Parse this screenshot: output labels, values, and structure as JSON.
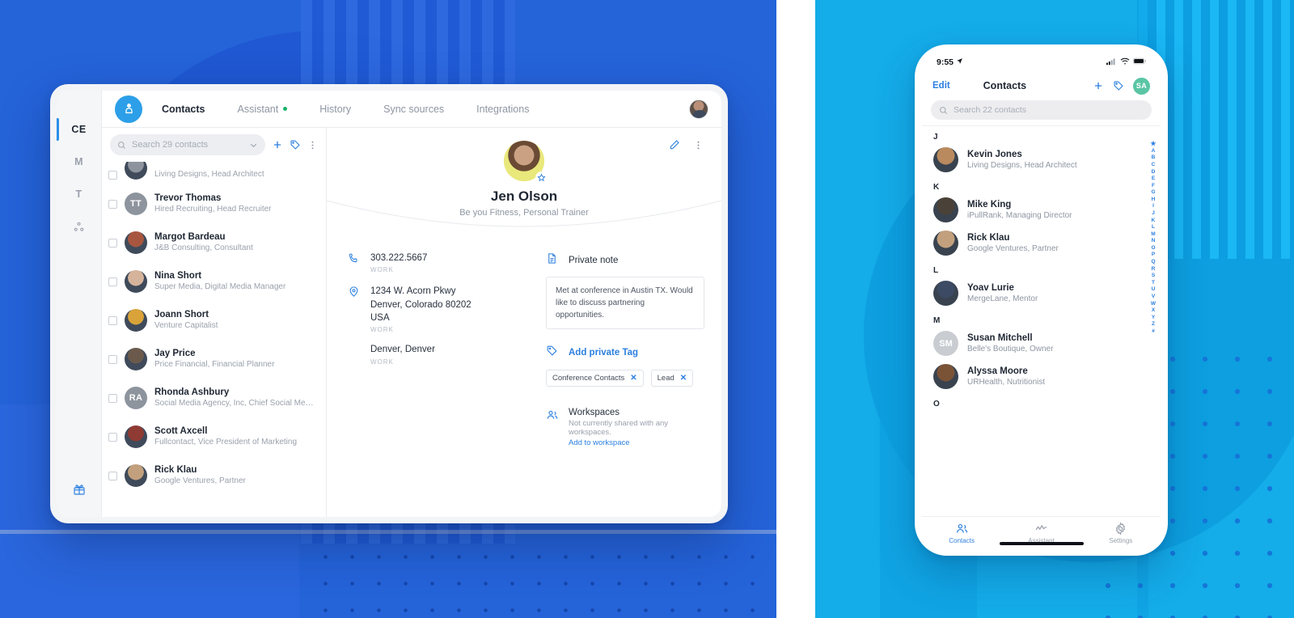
{
  "theme": {
    "left_bg": "#2563d9",
    "right_bg": "#14ace9",
    "accent_blue": "#2b7fe0",
    "logo_blue": "#2c9fe8",
    "green_dot": "#17b26a",
    "avatar_green": "#5ac5a5"
  },
  "desktop": {
    "logo_icon": "contact-card-icon",
    "tabs": [
      {
        "label": "Contacts",
        "active": true,
        "dot": false
      },
      {
        "label": "Assistant",
        "active": false,
        "dot": true
      },
      {
        "label": "History",
        "active": false,
        "dot": false
      },
      {
        "label": "Sync sources",
        "active": false,
        "dot": false
      },
      {
        "label": "Integrations",
        "active": false,
        "dot": false
      }
    ],
    "rail": [
      {
        "label": "CE",
        "active": true
      },
      {
        "label": "M",
        "active": false
      },
      {
        "label": "T",
        "active": false
      },
      {
        "label": "",
        "icon": "network-icon",
        "active": false
      }
    ],
    "rail_bottom_icon": "gift-icon",
    "list": {
      "search_placeholder": "Search 29 contacts",
      "chevron_icon": "chevron-down-icon",
      "add_icon": "plus-icon",
      "tag_icon": "tag-icon",
      "more_icon": "more-vertical-icon",
      "contacts": [
        {
          "name": "",
          "desc": "Living Designs, Head Architect",
          "initials": "",
          "color": "#8d949d",
          "partial": true
        },
        {
          "name": "Trevor Thomas",
          "desc": "Hired Recruiting, Head Recruiter",
          "initials": "TT",
          "color": "#8d949d"
        },
        {
          "name": "Margot Bardeau",
          "desc": "J&B Consulting, Consultant",
          "initials": "",
          "color": "#a8563f"
        },
        {
          "name": "Nina Short",
          "desc": "Super Media, Digital Media Manager",
          "initials": "",
          "color": "#d6b49c"
        },
        {
          "name": "Joann Short",
          "desc": "Venture Capitalist",
          "initials": "",
          "color": "#d9a33a"
        },
        {
          "name": "Jay Price",
          "desc": "Price Financial, Financial Planner",
          "initials": "",
          "color": "#6b5a4c"
        },
        {
          "name": "Rhonda Ashbury",
          "desc": "Social Media Agency, Inc, Chief Social Media St...",
          "initials": "RA",
          "color": "#8d949d"
        },
        {
          "name": "Scott Axcell",
          "desc": "Fullcontact, Vice President of Marketing",
          "initials": "",
          "color": "#8f3a33"
        },
        {
          "name": "Rick Klau",
          "desc": "Google Ventures, Partner",
          "initials": "",
          "color": "#c2a07d"
        }
      ]
    },
    "detail": {
      "edit_icon": "pencil-icon",
      "more_icon": "more-vertical-icon",
      "star_icon": "star-icon",
      "name": "Jen Olson",
      "subtitle": "Be you Fitness, Personal Trainer",
      "phone_icon": "phone-icon",
      "phone": "303.222.5667",
      "phone_label": "WORK",
      "location_icon": "location-pin-icon",
      "address": "1234 W. Acorn Pkwy\nDenver, Colorado 80202\nUSA",
      "address_label": "WORK",
      "city": "Denver, Denver",
      "city_label": "WORK",
      "note_icon": "document-icon",
      "note_title": "Private note",
      "note_body": "Met at conference in Austin TX. Would like to discuss partnering opportunities.",
      "add_tag_icon": "tag-icon",
      "add_tag_label": "Add private Tag",
      "tags": [
        "Conference Contacts",
        "Lead"
      ],
      "tag_remove_icon": "close-icon",
      "workspaces_icon": "people-icon",
      "workspaces_title": "Workspaces",
      "workspaces_desc": "Not currently shared with any workspaces.",
      "workspaces_link": "Add to workspace"
    }
  },
  "phone": {
    "status": {
      "time": "9:55",
      "location_icon": "location-arrow-icon",
      "cellular_icon": "signal-bars-icon",
      "wifi_icon": "wifi-icon",
      "battery_icon": "battery-icon"
    },
    "nav": {
      "edit": "Edit",
      "title": "Contacts",
      "add_icon": "plus-icon",
      "tag_icon": "tag-icon",
      "avatar_initials": "SA"
    },
    "search_placeholder": "Search 22 contacts",
    "search_icon": "search-icon",
    "sections": [
      {
        "letter": "J",
        "contacts": [
          {
            "name": "Kevin Jones",
            "desc": "Living Designs, Head Architect",
            "initials": "",
            "color": "#b98a5e"
          }
        ]
      },
      {
        "letter": "K",
        "contacts": [
          {
            "name": "Mike King",
            "desc": "iPullRank, Managing Director",
            "initials": "",
            "color": "#4a4138"
          },
          {
            "name": "Rick Klau",
            "desc": "Google Ventures, Partner",
            "initials": "",
            "color": "#c2a07d"
          }
        ]
      },
      {
        "letter": "L",
        "contacts": [
          {
            "name": "Yoav Lurie",
            "desc": "MergeLane, Mentor",
            "initials": "",
            "color": "#3c4a63"
          }
        ]
      },
      {
        "letter": "M",
        "contacts": [
          {
            "name": "Susan Mitchell",
            "desc": "Belle's Boutique, Owner",
            "initials": "SM",
            "color": "#c9cdd2"
          },
          {
            "name": "Alyssa Moore",
            "desc": "URHealth, Nutritionist",
            "initials": "",
            "color": "#7a5337"
          }
        ]
      },
      {
        "letter": "O",
        "contacts": []
      }
    ],
    "alpha_index": [
      "★",
      "A",
      "B",
      "C",
      "D",
      "E",
      "F",
      "G",
      "H",
      "I",
      "J",
      "K",
      "L",
      "M",
      "N",
      "O",
      "P",
      "Q",
      "R",
      "S",
      "T",
      "U",
      "V",
      "W",
      "X",
      "Y",
      "Z",
      "#"
    ],
    "tabbar": [
      {
        "label": "Contacts",
        "icon": "people-icon",
        "active": true
      },
      {
        "label": "Assistant",
        "icon": "activity-icon",
        "active": false
      },
      {
        "label": "Settings",
        "icon": "gear-icon",
        "active": false
      }
    ]
  }
}
